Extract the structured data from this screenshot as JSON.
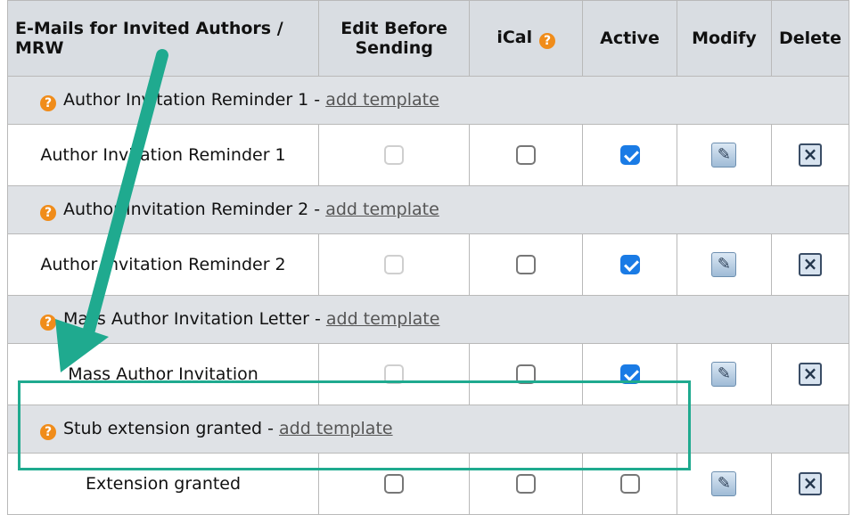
{
  "header": {
    "col_name": "E-Mails for Invited Authors / MRW",
    "col_edit": "Edit Before Sending",
    "col_ical": "iCal",
    "col_active": "Active",
    "col_modify": "Modify",
    "col_delete": "Delete"
  },
  "groups": [
    {
      "title": "Author Invitation Reminder 1 - ",
      "link": "add template",
      "item": {
        "name": "Author Invitation Reminder 1",
        "edit": "disabled",
        "ical": false,
        "active": true
      }
    },
    {
      "title": "Author Invitation Reminder 2 - ",
      "link": "add template",
      "item": {
        "name": "Author Invitation Reminder 2",
        "edit": "disabled",
        "ical": false,
        "active": true
      }
    },
    {
      "title": "Mass Author Invitation Letter - ",
      "link": "add template",
      "item": {
        "name": "Mass Author Invitation",
        "edit": "disabled",
        "ical": false,
        "active": true
      }
    },
    {
      "title": "Stub extension granted - ",
      "link": "add template",
      "item": {
        "name": "Extension granted",
        "edit": false,
        "ical": false,
        "active": false
      }
    }
  ],
  "colors": {
    "highlight": "#1faa8f",
    "arrow": "#1faa8f",
    "help_icon": "#f08c1a",
    "checkbox_on": "#1a7be5"
  }
}
